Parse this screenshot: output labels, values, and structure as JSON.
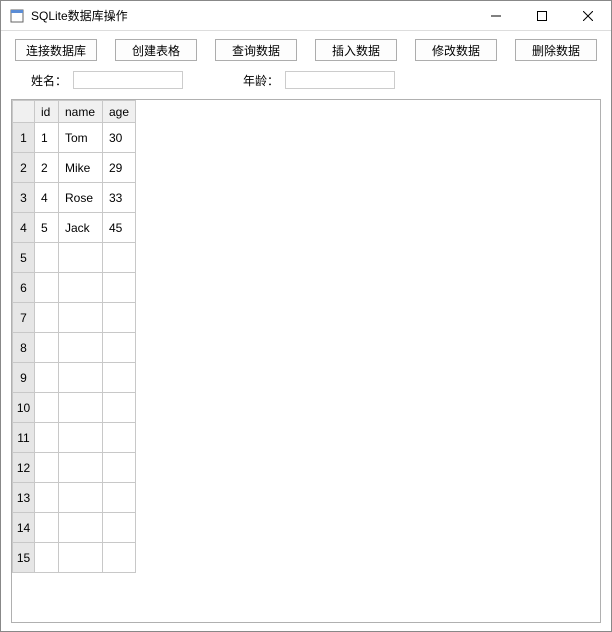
{
  "window": {
    "title": "SQLite数据库操作"
  },
  "toolbar": {
    "connect_label": "连接数据库",
    "create_label": "创建表格",
    "query_label": "查询数据",
    "insert_label": "插入数据",
    "update_label": "修改数据",
    "delete_label": "删除数据"
  },
  "form": {
    "name_label": "姓名：",
    "name_value": "",
    "age_label": "年龄：",
    "age_value": ""
  },
  "table": {
    "columns": [
      "id",
      "name",
      "age"
    ],
    "total_rows": 15,
    "rows": [
      {
        "id": "1",
        "name": "Tom",
        "age": "30"
      },
      {
        "id": "2",
        "name": "Mike",
        "age": "29"
      },
      {
        "id": "4",
        "name": "Rose",
        "age": "33"
      },
      {
        "id": "5",
        "name": "Jack",
        "age": "45"
      }
    ]
  }
}
